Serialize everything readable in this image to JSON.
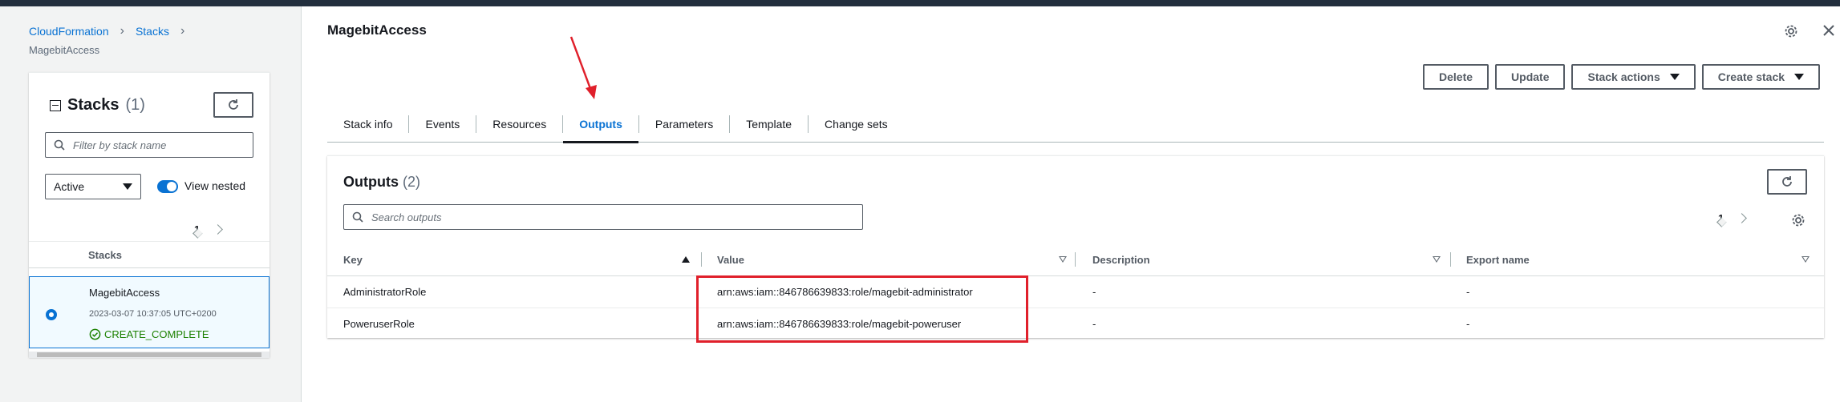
{
  "breadcrumb": {
    "root": "CloudFormation",
    "parent": "Stacks",
    "current": "MagebitAccess"
  },
  "stacks_panel": {
    "title": "Stacks",
    "count": "(1)",
    "filter_placeholder": "Filter by stack name",
    "status_filter": "Active",
    "view_nested_label": "View nested",
    "page": "1",
    "column_header": "Stacks",
    "stack": {
      "name": "MagebitAccess",
      "timestamp": "2023-03-07 10:37:05 UTC+0200",
      "status": "CREATE_COMPLETE"
    }
  },
  "stack_detail": {
    "title": "MagebitAccess",
    "actions": {
      "delete": "Delete",
      "update": "Update",
      "stack_actions": "Stack actions",
      "create_stack": "Create stack"
    },
    "tabs": [
      "Stack info",
      "Events",
      "Resources",
      "Outputs",
      "Parameters",
      "Template",
      "Change sets"
    ],
    "active_tab": "Outputs"
  },
  "outputs": {
    "title": "Outputs",
    "count": "(2)",
    "search_placeholder": "Search outputs",
    "page": "1",
    "columns": {
      "key": "Key",
      "value": "Value",
      "description": "Description",
      "export_name": "Export name"
    },
    "rows": [
      {
        "key": "AdministratorRole",
        "value": "arn:aws:iam::846786639833:role/magebit-administrator",
        "description": "-",
        "export_name": "-"
      },
      {
        "key": "PoweruserRole",
        "value": "arn:aws:iam::846786639833:role/magebit-poweruser",
        "description": "-",
        "export_name": "-"
      }
    ]
  },
  "colors": {
    "link": "#0972d3",
    "success": "#1d8102",
    "annotation": "#e0202b",
    "topbar": "#232f3e"
  }
}
